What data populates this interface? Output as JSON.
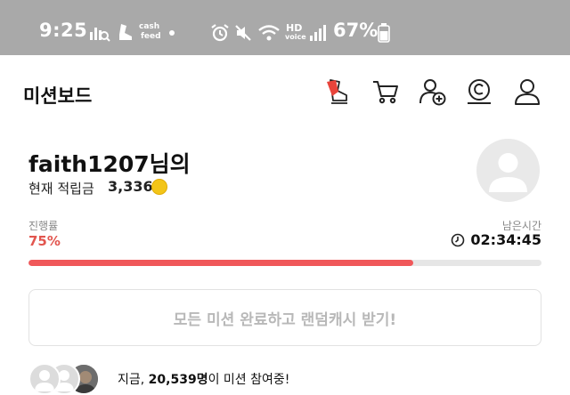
{
  "status_bar": {
    "time": "9:25",
    "hd_label": "HD",
    "voice_label": "voice",
    "cash_label": "cash",
    "feed_label": "feed",
    "battery_percent": "67%",
    "icons": [
      "chart-search-icon",
      "cashfeed-app-icon",
      "notification-dot",
      "alarm-icon",
      "mute-icon",
      "wifi-icon",
      "hd-voice-icon",
      "signal-icon",
      "battery-icon"
    ]
  },
  "header": {
    "title": "미션보드",
    "buttons": [
      "mission-shoe-icon",
      "cart-icon",
      "add-friend-icon",
      "cash-coin-icon",
      "profile-icon"
    ],
    "accent_color": "#e8443b"
  },
  "profile": {
    "username": "faith1207님의",
    "points_label": "현재 적립금",
    "points_value": "3,336"
  },
  "progress": {
    "label": "진행률",
    "value_text": "75%",
    "fraction": 0.75,
    "remaining_label": "남은시간",
    "timer": "02:34:45",
    "fill_color": "#f0585a"
  },
  "random_cash": {
    "label": "모든 미션 완료하고 랜덤캐시 받기!"
  },
  "participants": {
    "prefix": "지금,",
    "count": "20,539명",
    "suffix": "이 미션 참여중!"
  }
}
